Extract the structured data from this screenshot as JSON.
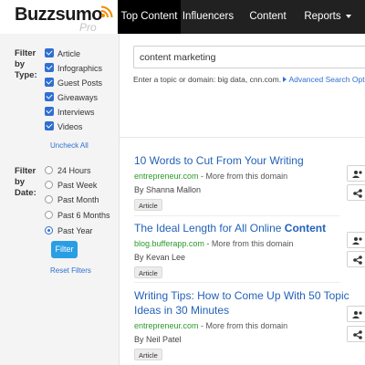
{
  "app": {
    "logo_text": "Buzzsumo",
    "logo_sub": "Pro"
  },
  "nav": {
    "items": [
      {
        "label": "Top Content",
        "active": true
      },
      {
        "label": "Influencers",
        "active": false
      },
      {
        "label": "Content Alerts",
        "active": false
      },
      {
        "label": "Reports",
        "active": false
      }
    ]
  },
  "sidebar": {
    "type_filter": {
      "title_lines": [
        "Filter",
        "by",
        "Type:"
      ],
      "options": [
        {
          "label": "Article",
          "checked": true
        },
        {
          "label": "Infographics",
          "checked": true
        },
        {
          "label": "Guest Posts",
          "checked": true
        },
        {
          "label": "Giveaways",
          "checked": true
        },
        {
          "label": "Interviews",
          "checked": true
        },
        {
          "label": "Videos",
          "checked": true
        }
      ],
      "uncheck_all": "Uncheck All"
    },
    "date_filter": {
      "title_lines": [
        "Filter",
        "by",
        "Date:"
      ],
      "options": [
        {
          "label": "24 Hours",
          "selected": false
        },
        {
          "label": "Past Week",
          "selected": false
        },
        {
          "label": "Past Month",
          "selected": false
        },
        {
          "label": "Past 6 Months",
          "selected": false
        },
        {
          "label": "Past Year",
          "selected": true
        }
      ]
    },
    "filter_button": "Filter",
    "reset_filters": "Reset Filters"
  },
  "search": {
    "value": "content marketing",
    "hint": "Enter a topic or domain: big data, cnn.com.",
    "advanced_label": "Advanced Search Optio"
  },
  "results": [
    {
      "title_parts": [
        {
          "text": "10 Words to Cut From Your Writing",
          "bold": false
        }
      ],
      "domain": "entrepreneur.com",
      "domain_more": " - More from this domain",
      "author": "By Shanna Mallon",
      "tag": "Article"
    },
    {
      "title_parts": [
        {
          "text": "The Ideal Length for All Online ",
          "bold": false
        },
        {
          "text": "Content",
          "bold": true
        }
      ],
      "domain": "blog.bufferapp.com",
      "domain_more": " - More from this domain",
      "author": "By Kevan Lee",
      "tag": "Article"
    },
    {
      "title_parts": [
        {
          "text": "Writing Tips: How to Come Up With 50 Topic Ideas in 30 Minutes",
          "bold": false
        }
      ],
      "domain": "entrepreneur.com",
      "domain_more": " - More from this domain",
      "author": "By Neil Patel",
      "tag": "Article"
    }
  ],
  "colors": {
    "accent": "#2f6fd0",
    "link_title": "#2361b8",
    "domain_green": "#2b9a2b",
    "nav_bg": "#212121",
    "button_blue": "#2a9ee5"
  }
}
